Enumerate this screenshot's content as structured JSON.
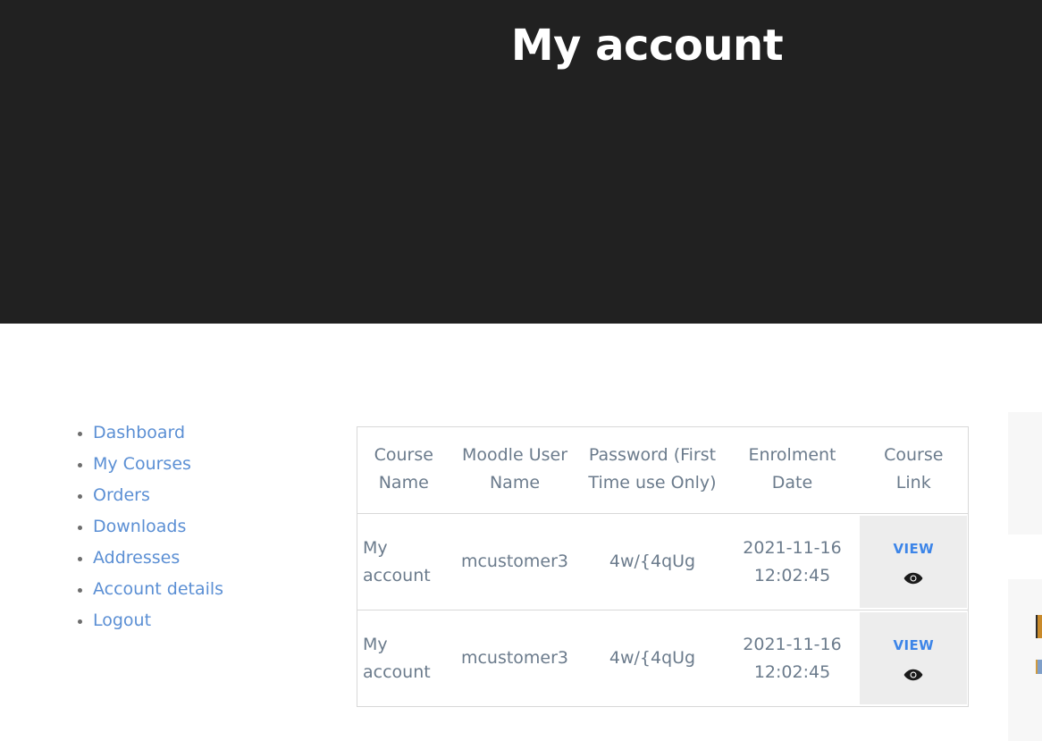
{
  "header": {
    "title": "My account",
    "background_color": "#212121",
    "title_color": "#ffffff"
  },
  "sidebar": {
    "name": "account-navigation",
    "link_color": "#5b8fd4",
    "items": [
      {
        "label": "Dashboard"
      },
      {
        "label": "My Courses"
      },
      {
        "label": "Orders"
      },
      {
        "label": "Downloads"
      },
      {
        "label": "Addresses"
      },
      {
        "label": "Account details"
      },
      {
        "label": "Logout"
      }
    ]
  },
  "courses_table": {
    "columns": [
      {
        "label": "Course Name"
      },
      {
        "label": "Moodle User Name"
      },
      {
        "label": "Password (First Time use Only)"
      },
      {
        "label": "Enrolment Date"
      },
      {
        "label": "Course Link"
      }
    ],
    "rows": [
      {
        "course_name": "My account",
        "moodle_user_name": "mcustomer3",
        "password": "4w/{4qUg",
        "enrolment_date_day": "2021-11-16",
        "enrolment_date_time": "12:02:45",
        "action_label": "VIEW",
        "action_icon": "eye-icon"
      },
      {
        "course_name": "My account",
        "moodle_user_name": "mcustomer3",
        "password": "4w/{4qUg",
        "enrolment_date_day": "2021-11-16",
        "enrolment_date_time": "12:02:45",
        "action_label": "VIEW",
        "action_icon": "eye-icon"
      }
    ],
    "view_button_color": "#3d85e8",
    "view_button_background": "#ededed",
    "border_color": "#d8d8d8",
    "text_color": "#6b7b8c"
  }
}
